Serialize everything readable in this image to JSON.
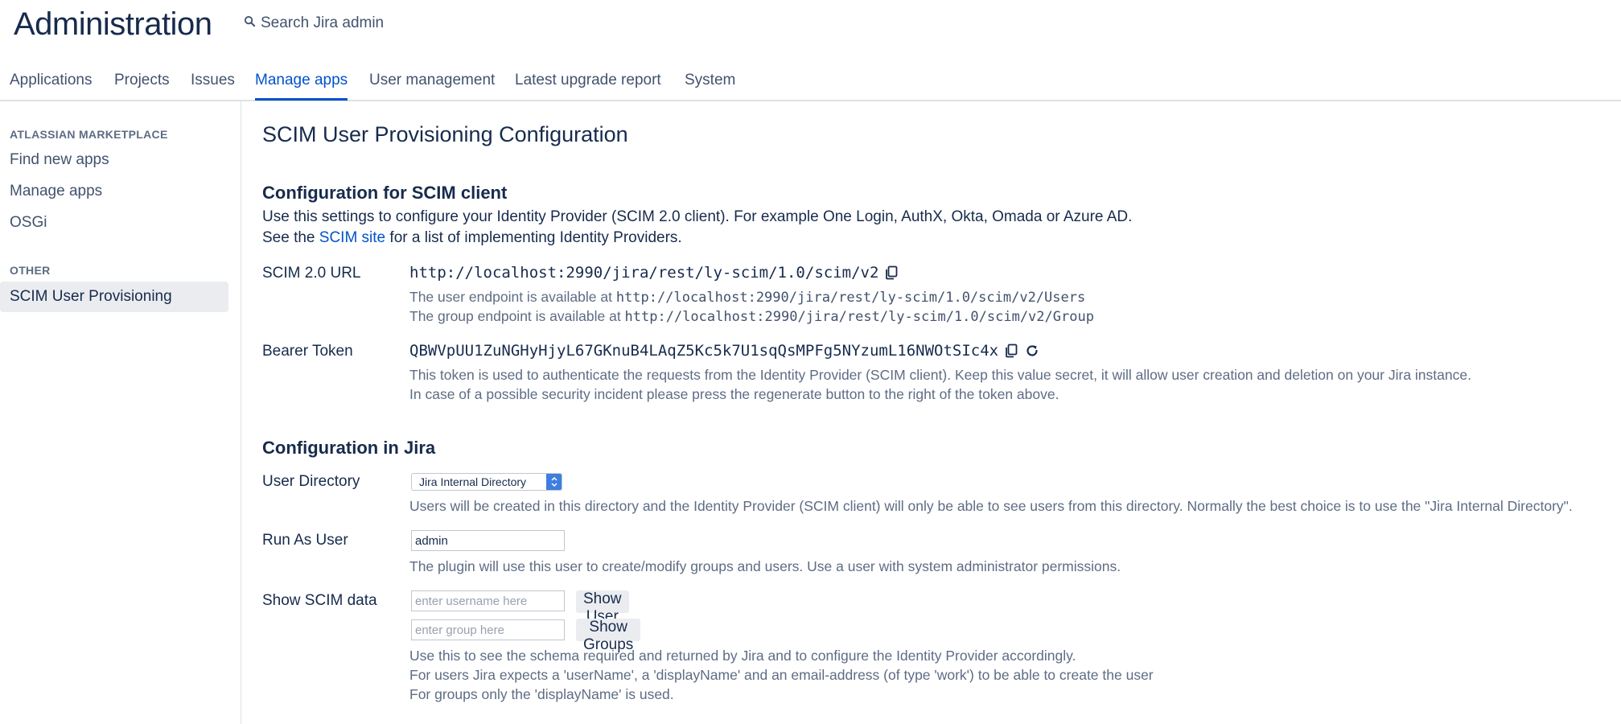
{
  "header": {
    "title": "Administration",
    "search_label": "Search Jira admin"
  },
  "tabs": [
    {
      "label": "Applications",
      "active": false
    },
    {
      "label": "Projects",
      "active": false
    },
    {
      "label": "Issues",
      "active": false
    },
    {
      "label": "Manage apps",
      "active": true
    },
    {
      "label": "User management",
      "active": false
    },
    {
      "label": "Latest upgrade report",
      "active": false
    },
    {
      "label": "System",
      "active": false
    }
  ],
  "sidebar": {
    "sections": [
      {
        "heading": "ATLASSIAN MARKETPLACE",
        "items": [
          "Find new apps",
          "Manage apps",
          "OSGi"
        ]
      },
      {
        "heading": "OTHER",
        "items": [
          "SCIM User Provisioning"
        ]
      }
    ],
    "selected_item": "SCIM User Provisioning"
  },
  "main": {
    "title": "SCIM User Provisioning Configuration",
    "client_section": {
      "heading": "Configuration for SCIM client",
      "intro_line1": "Use this settings to configure your Identity Provider (SCIM 2.0 client). For example One Login, AuthX, Okta, Omada or Azure AD.",
      "intro_line2_prefix": "See the ",
      "intro_line2_link": "SCIM site",
      "intro_line2_suffix": " for a list of implementing Identity Providers.",
      "url_label": "SCIM 2.0 URL",
      "url_value": "http://localhost:2990/jira/rest/ly-scim/1.0/scim/v2",
      "user_endpoint_prefix": "The user endpoint is available at ",
      "user_endpoint_url": "http://localhost:2990/jira/rest/ly-scim/1.0/scim/v2/Users",
      "group_endpoint_prefix": "The group endpoint is available at ",
      "group_endpoint_url": "http://localhost:2990/jira/rest/ly-scim/1.0/scim/v2/Group",
      "token_label": "Bearer Token",
      "token_value": "QBWVpUU1ZuNGHyHjyL67GKnuB4LAqZ5Kc5k7U1sqQsMPFg5NYzumL16NWOtSIc4x",
      "token_desc1": "This token is used to authenticate the requests from the Identity Provider (SCIM client). Keep this value secret, it will allow user creation and deletion on your Jira instance.",
      "token_desc2": "In case of a possible security incident please press the regenerate button to the right of the token above."
    },
    "jira_section": {
      "heading": "Configuration in Jira",
      "directory_label": "User Directory",
      "directory_value": "Jira Internal Directory",
      "directory_desc": "Users will be created in this directory and the Identity Provider (SCIM client) will only be able to see users from this directory. Normally the best choice is to use the \"Jira Internal Directory\".",
      "run_as_label": "Run As User",
      "run_as_value": "admin",
      "run_as_desc": "The plugin will use this user to create/modify groups and users. Use a user with system administrator permissions.",
      "show_label": "Show SCIM data",
      "username_placeholder": "enter username here",
      "show_user_button": "Show User",
      "group_placeholder": "enter group here",
      "show_groups_button": "Show Groups",
      "show_desc1": "Use this to see the schema required and returned by Jira and to configure the Identity Provider accordingly.",
      "show_desc2": "For users Jira expects a 'userName', a 'displayName' and an email-address (of type 'work') to be able to create the user",
      "show_desc3": "For groups only the 'displayName' is used."
    }
  }
}
